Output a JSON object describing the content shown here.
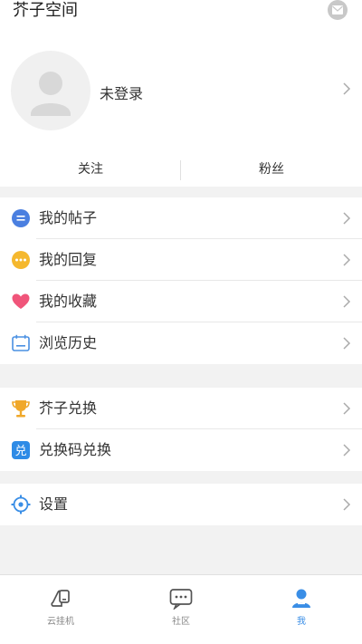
{
  "header": {
    "title": "芥子空间",
    "message_icon": "message-icon"
  },
  "profile": {
    "avatar_icon": "default-avatar-icon",
    "login_status": "未登录",
    "stats": [
      {
        "label": "关注"
      },
      {
        "label": "粉丝"
      }
    ]
  },
  "menu_groups": [
    [
      {
        "label": "我的帖子",
        "icon": "post-icon"
      },
      {
        "label": "我的回复",
        "icon": "reply-icon"
      },
      {
        "label": "我的收藏",
        "icon": "heart-icon"
      },
      {
        "label": "浏览历史",
        "icon": "history-icon"
      }
    ],
    [
      {
        "label": "芥子兑换",
        "icon": "trophy-icon"
      },
      {
        "label": "兑换码兑换",
        "icon": "redeem-code-icon"
      }
    ],
    [
      {
        "label": "设置",
        "icon": "settings-icon"
      }
    ]
  ],
  "tabbar": {
    "tabs": [
      {
        "label": "云挂机",
        "icon": "cloud-device-icon",
        "active": false
      },
      {
        "label": "社区",
        "icon": "chat-icon",
        "active": false
      },
      {
        "label": "我",
        "icon": "user-icon",
        "active": true
      }
    ]
  },
  "colors": {
    "accent": "#3a8ee6",
    "post": "#4a7fe0",
    "reply": "#f5b82e",
    "heart": "#f0557a",
    "history": "#4a90e2",
    "trophy": "#f0a82a",
    "redeem": "#2e8be6",
    "settings": "#3a8ee6"
  }
}
